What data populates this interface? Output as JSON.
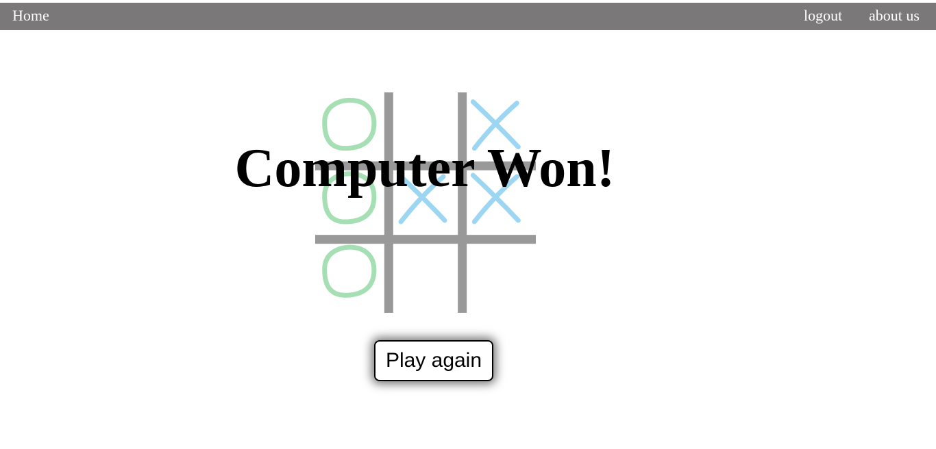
{
  "nav": {
    "home_label": "Home",
    "logout_label": "logout",
    "about_label": "about us",
    "bg_color": "#7a7879"
  },
  "board": {
    "cells": [
      [
        "O",
        "",
        "X"
      ],
      [
        "O",
        "X",
        "X"
      ],
      [
        "O",
        "",
        ""
      ]
    ],
    "grid_color": "#999999",
    "o_color": "#a6dfb3",
    "x_color": "#9cd6f2"
  },
  "result": {
    "message": "Computer Won!"
  },
  "actions": {
    "play_again_label": "Play again"
  }
}
